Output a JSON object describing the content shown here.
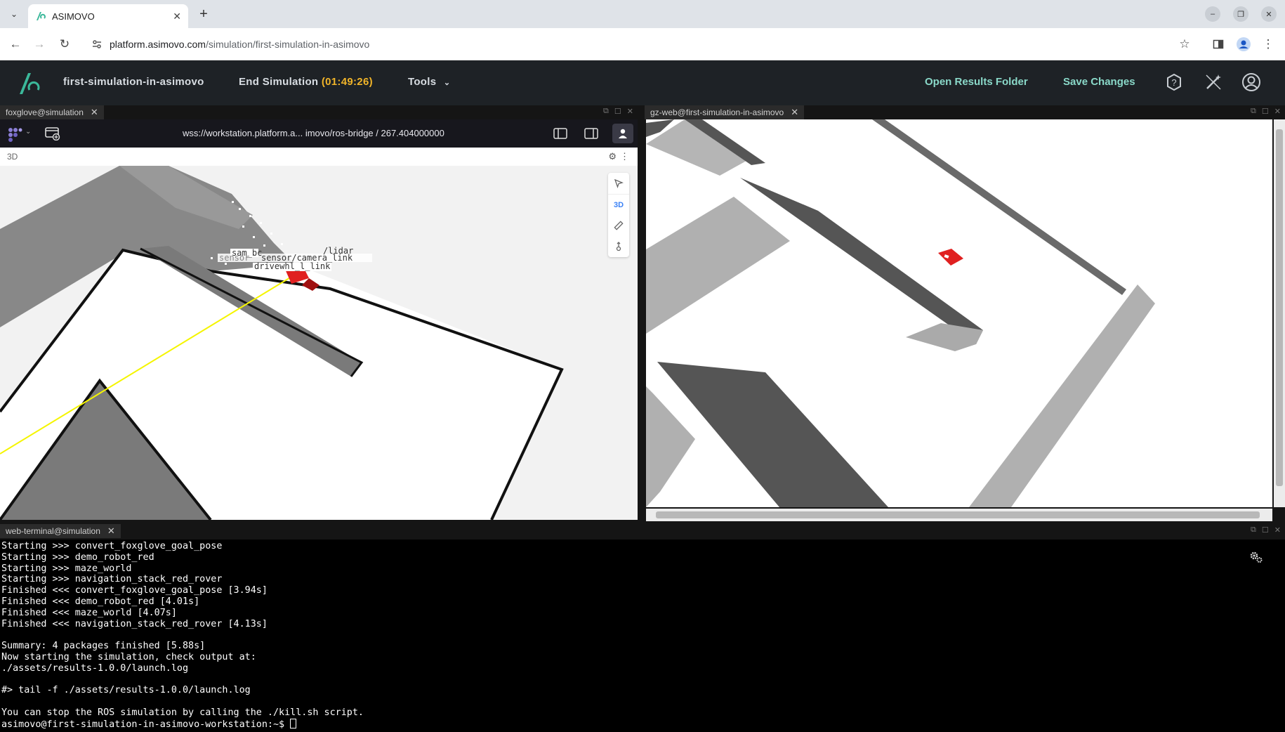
{
  "browser": {
    "tab_title": "ASIMOVO",
    "url_domain": "platform.asimovo.com",
    "url_path": "/simulation/first-simulation-in-asimovo"
  },
  "header": {
    "project_name": "first-simulation-in-asimovo",
    "end_simulation_label": "End Simulation",
    "timer": "(01:49:26)",
    "tools_label": "Tools",
    "open_results_label": "Open Results Folder",
    "save_changes_label": "Save Changes"
  },
  "panels": {
    "foxglove_tab": "foxglove@simulation",
    "gz_tab": "gz-web@first-simulation-in-asimovo",
    "terminal_tab": "web-terminal@simulation"
  },
  "foxglove": {
    "connection": "wss://workstation.platform.a... imovo/ros-bridge / 267.404000000",
    "panel_label": "3D",
    "tool_3d": "3D",
    "frame_labels": [
      "sam_bc",
      "sensor/camera_link",
      "/lidar",
      "sensor",
      "drivewhl_l_link"
    ]
  },
  "terminal": {
    "lines": [
      "Starting >>> convert_foxglove_goal_pose",
      "Starting >>> demo_robot_red",
      "Starting >>> maze_world",
      "Starting >>> navigation_stack_red_rover",
      "Finished <<< convert_foxglove_goal_pose [3.94s]",
      "Finished <<< demo_robot_red [4.01s]",
      "Finished <<< maze_world [4.07s]",
      "Finished <<< navigation_stack_red_rover [4.13s]",
      "",
      "Summary: 4 packages finished [5.88s]",
      "Now starting the simulation, check output at:",
      "./assets/results-1.0.0/launch.log",
      "",
      "#> tail -f ./assets/results-1.0.0/launch.log",
      "",
      "You can stop the ROS simulation by calling the ./kill.sh script."
    ],
    "prompt": "asimovo@first-simulation-in-asimovo-workstation:~$ "
  },
  "colors": {
    "header_bg": "#1e2226",
    "accent_teal": "#8ad9c9",
    "timer_orange": "#f0b429",
    "robot_red": "#e02020",
    "laser_yellow": "#f5f500"
  }
}
